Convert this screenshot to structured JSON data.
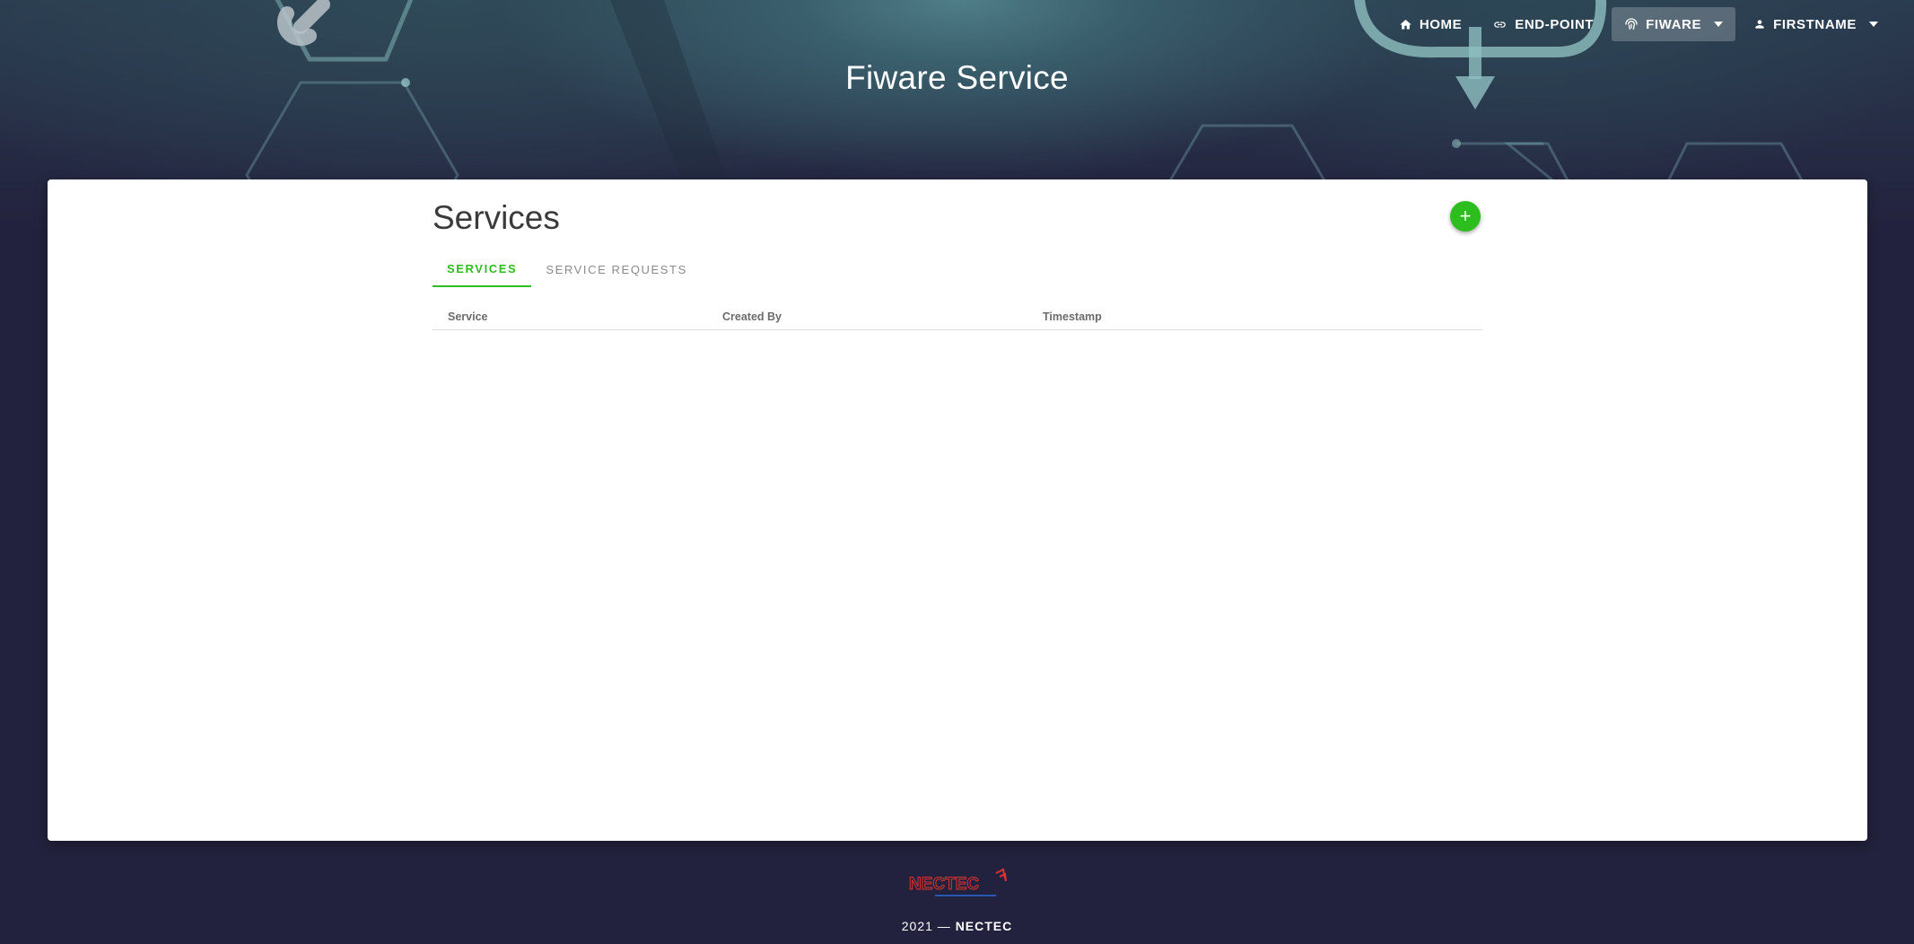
{
  "nav": {
    "items": [
      {
        "label": "HOME",
        "icon": "home-icon"
      },
      {
        "label": "END-POINT",
        "icon": "link-icon"
      },
      {
        "label": "FIWARE",
        "icon": "fingerprint-icon",
        "active": true
      },
      {
        "label": "FIRSTNAME",
        "icon": "person-icon"
      }
    ]
  },
  "header": {
    "title": "Fiware Service"
  },
  "main": {
    "title": "Services",
    "add_label": "+",
    "tabs": [
      {
        "label": "SERVICES",
        "active": true
      },
      {
        "label": "SERVICE REQUESTS",
        "active": false
      }
    ],
    "table": {
      "columns": [
        "Service",
        "Created By",
        "Timestamp"
      ],
      "rows": []
    }
  },
  "footer": {
    "year": "2021 —",
    "org": "NECTEC",
    "logo_text": "NECTEC"
  },
  "colors": {
    "accent": "#2ebd1f",
    "background": "#23223e",
    "logo_red": "#e0312b",
    "logo_blue": "#2b6ad8"
  }
}
